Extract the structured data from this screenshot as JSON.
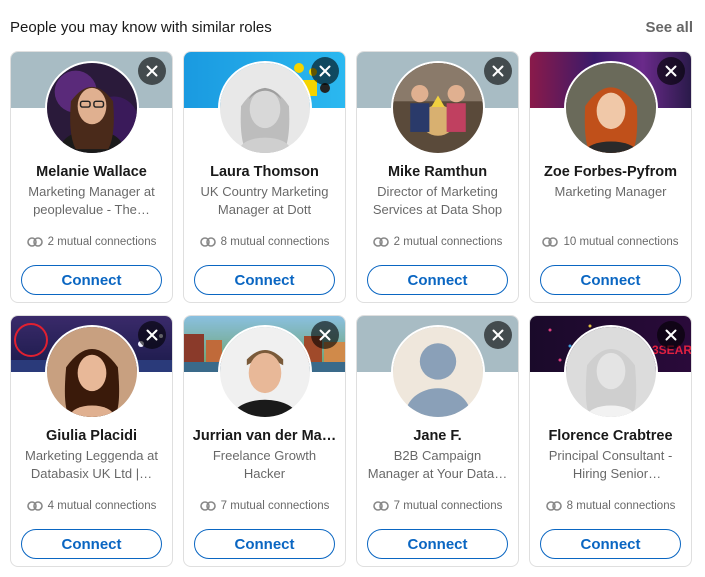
{
  "header": {
    "title": "People you may know with similar roles",
    "see_all": "See all"
  },
  "connect_label": "Connect",
  "colors": {
    "accent": "#0a66c2",
    "border": "#dfdfdf",
    "muted_text": "rgba(0,0,0,0.6)"
  },
  "people": [
    {
      "name": "Melanie Wallace",
      "headline": "Marketing Manager at peoplevalue - The…",
      "mutual": "2 mutual connections"
    },
    {
      "name": "Laura Thomson",
      "headline": "UK Country Marketing Manager at Dott",
      "mutual": "8 mutual connections"
    },
    {
      "name": "Mike Ramthun",
      "headline": "Director of Marketing Services at Data Shop",
      "mutual": "2 mutual connections"
    },
    {
      "name": "Zoe Forbes-Pyfrom",
      "headline": "Marketing Manager",
      "mutual": "10 mutual connections"
    },
    {
      "name": "Giulia Placidi",
      "headline": "Marketing Leggenda at Databasix UK Ltd |…",
      "mutual": "4 mutual connections"
    },
    {
      "name": "Jurrian van der Ma…",
      "headline": "Freelance Growth Hacker",
      "mutual": "7 mutual connections"
    },
    {
      "name": "Jane F.",
      "headline": "B2B Campaign Manager at Your Data…",
      "mutual": "7 mutual connections"
    },
    {
      "name": "Florence Crabtree",
      "headline": "Principal Consultant - Hiring Senior Marketin…",
      "mutual": "8 mutual connections"
    }
  ],
  "icons": {
    "dismiss": "close-icon",
    "mutual": "mutual-connections-icon",
    "avatar_placeholder": "default-avatar-icon"
  }
}
